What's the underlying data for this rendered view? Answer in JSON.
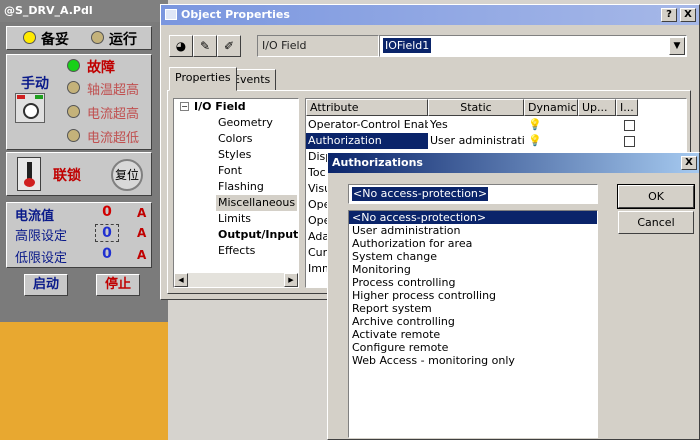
{
  "pdl_window": {
    "title": "@S_DRV_A.Pdl",
    "status_standby": "备妥",
    "status_running": "运行",
    "manual_label": "手动",
    "fault_label": "故障",
    "bearing_overtemp": "轴温超高",
    "current_high": "电流超高",
    "current_low": "电流超低",
    "interlock_label": "联锁",
    "reset_label": "复位",
    "current_value_label": "电流值",
    "high_limit_label": "高限设定",
    "low_limit_label": "低限设定",
    "current_value": "0",
    "high_limit": "0",
    "low_limit": "0",
    "unit": "A",
    "start_button": "启动",
    "stop_button": "停止"
  },
  "object_properties": {
    "title": "Object Properties",
    "help_button": "?",
    "close_button": "X",
    "object_type": "I/O Field",
    "object_name": "IOField1",
    "tabs": [
      "Properties",
      "Events"
    ],
    "tree_root": "I/O Field",
    "tree_items": [
      "Geometry",
      "Colors",
      "Styles",
      "Font",
      "Flashing",
      "Miscellaneous",
      "Limits",
      "Output/Input",
      "Effects"
    ],
    "grid_headers": [
      "Attribute",
      "Static",
      "Dynamic",
      "Up...",
      "I..."
    ],
    "grid_rows": [
      {
        "attribute": "Operator-Control Enable",
        "static": "Yes"
      },
      {
        "attribute": "Authorization",
        "static": "User administration"
      },
      {
        "attribute": "Disp",
        "static": ""
      },
      {
        "attribute": "Toc",
        "static": ""
      },
      {
        "attribute": "Visu",
        "static": ""
      },
      {
        "attribute": "Ope",
        "static": ""
      },
      {
        "attribute": "Ope",
        "static": ""
      },
      {
        "attribute": "Ada",
        "static": ""
      },
      {
        "attribute": "Cur",
        "static": ""
      },
      {
        "attribute": "Imm",
        "static": ""
      }
    ]
  },
  "authorizations": {
    "title": "Authorizations",
    "close_button": "X",
    "selected_value": "<No access-protection>",
    "ok_button": "OK",
    "cancel_button": "Cancel",
    "options": [
      "<No access-protection>",
      "User administration",
      "Authorization for area",
      "System change",
      "Monitoring",
      "Process controlling",
      "Higher process controlling",
      "Report system",
      "Archive controlling",
      "Activate remote",
      "Configure remote",
      "Web Access - monitoring only"
    ]
  }
}
